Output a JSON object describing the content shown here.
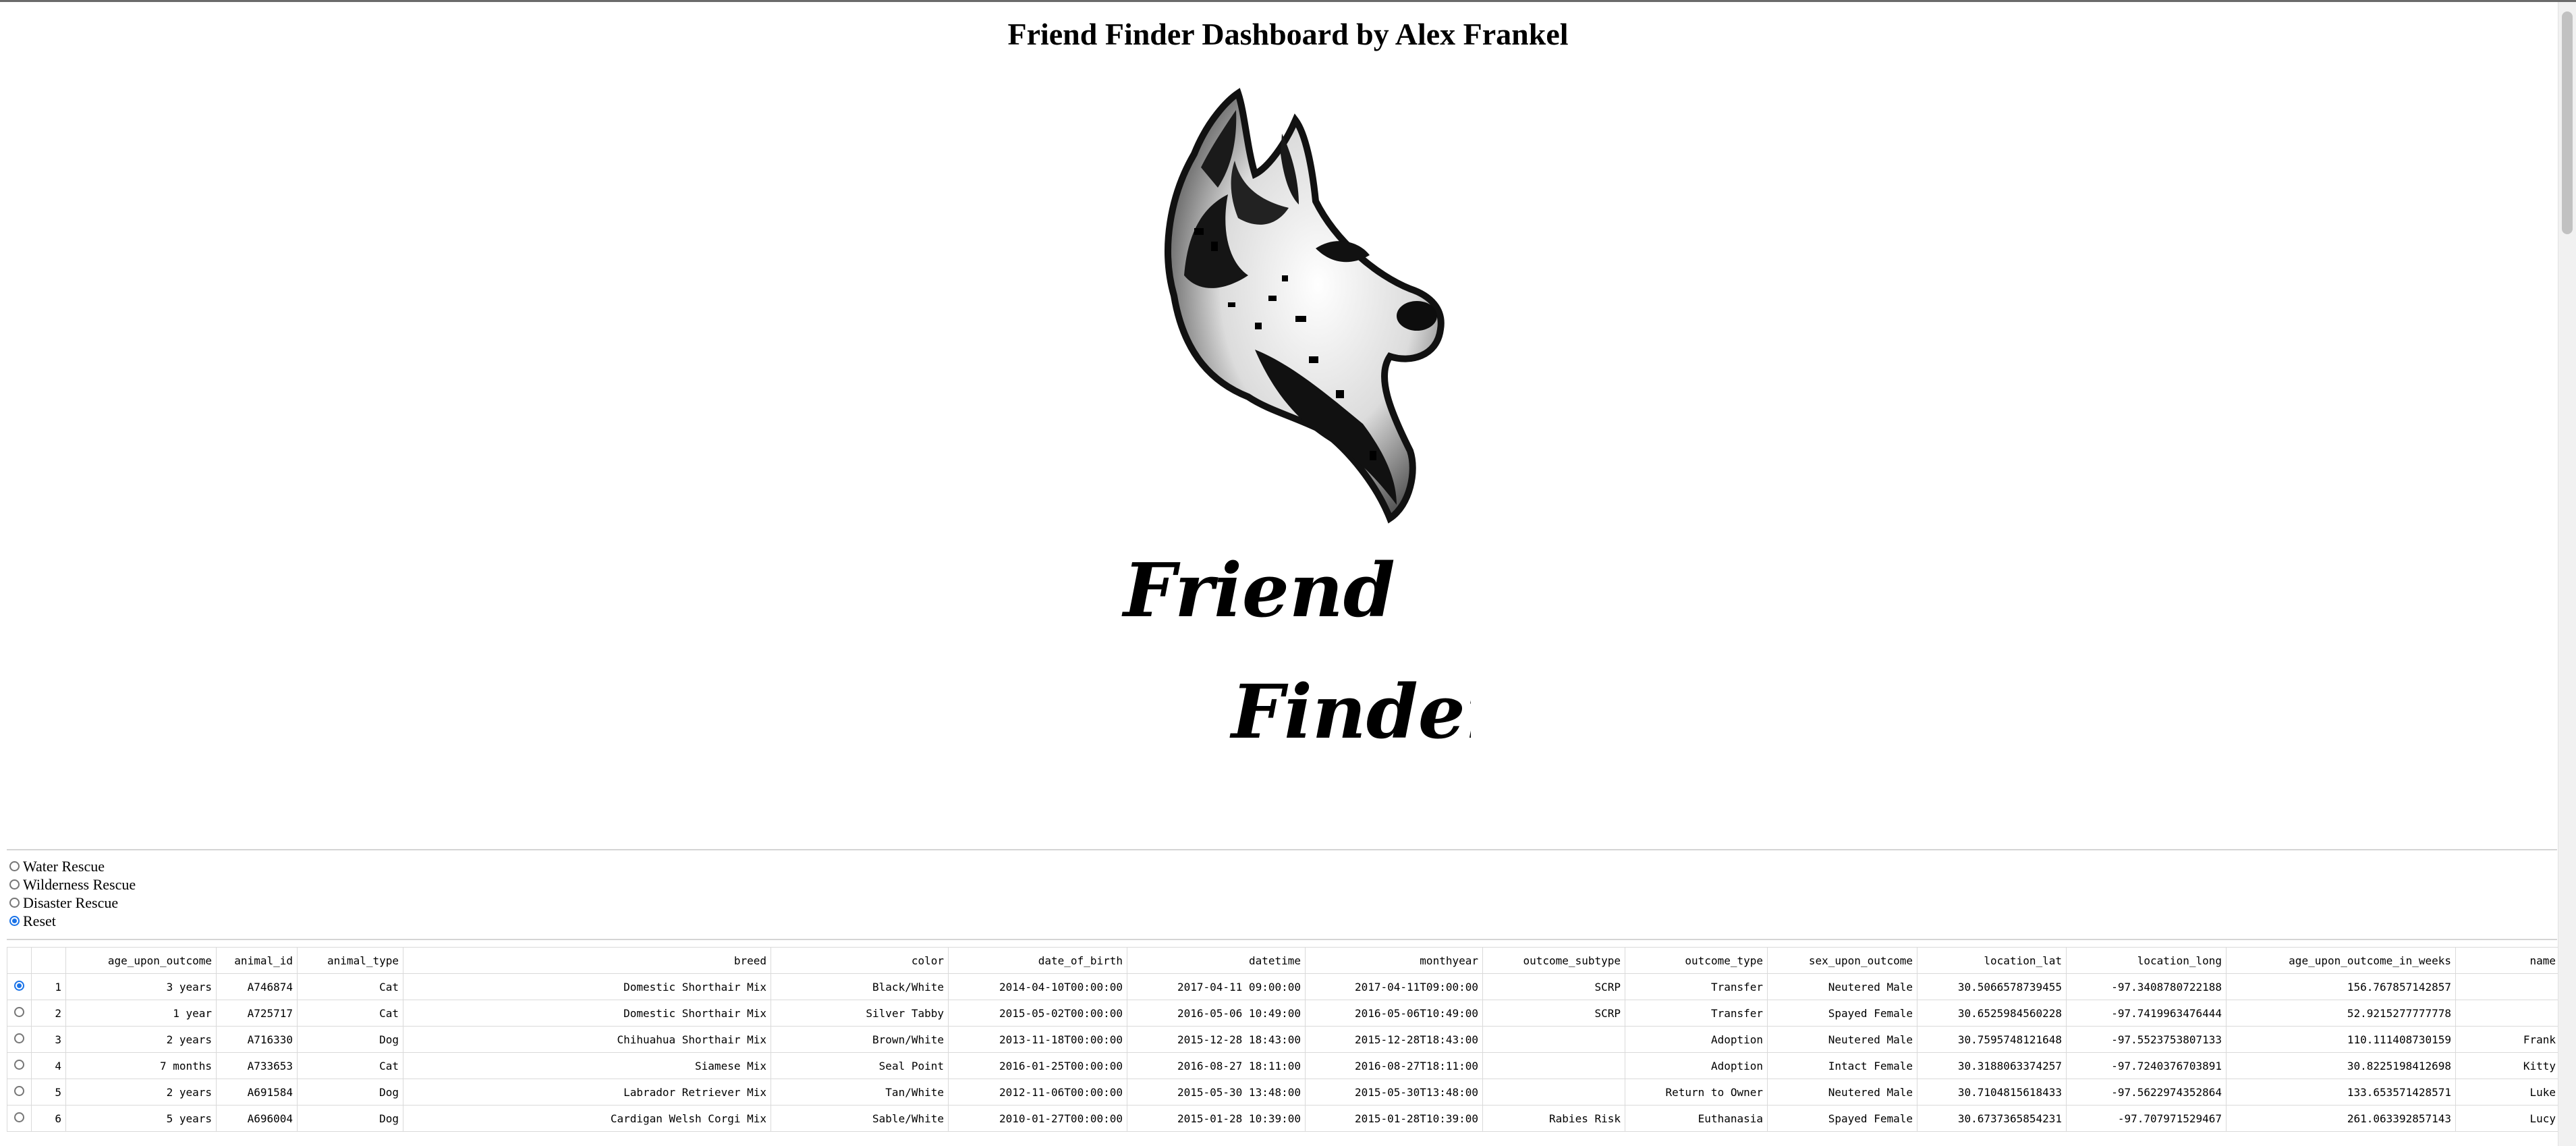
{
  "header": {
    "title": "Friend Finder Dashboard by Alex Frankel"
  },
  "logo": {
    "line1": "Friend",
    "line2": "Finder"
  },
  "filters": {
    "options": [
      {
        "label": "Water Rescue",
        "selected": false
      },
      {
        "label": "Wilderness Rescue",
        "selected": false
      },
      {
        "label": "Disaster Rescue",
        "selected": false
      },
      {
        "label": "Reset",
        "selected": true
      }
    ]
  },
  "table": {
    "columns": [
      "",
      "",
      "age_upon_outcome",
      "animal_id",
      "animal_type",
      "breed",
      "color",
      "date_of_birth",
      "datetime",
      "monthyear",
      "outcome_subtype",
      "outcome_type",
      "sex_upon_outcome",
      "location_lat",
      "location_long",
      "age_upon_outcome_in_weeks",
      "name"
    ],
    "rows": [
      [
        "1",
        "3 years",
        "A746874",
        "Cat",
        "Domestic Shorthair Mix",
        "Black/White",
        "2014-04-10T00:00:00",
        "2017-04-11 09:00:00",
        "2017-04-11T09:00:00",
        "SCRP",
        "Transfer",
        "Neutered Male",
        "30.5066578739455",
        "-97.3408780722188",
        "156.767857142857",
        ""
      ],
      [
        "2",
        "1 year",
        "A725717",
        "Cat",
        "Domestic Shorthair Mix",
        "Silver Tabby",
        "2015-05-02T00:00:00",
        "2016-05-06 10:49:00",
        "2016-05-06T10:49:00",
        "SCRP",
        "Transfer",
        "Spayed Female",
        "30.6525984560228",
        "-97.7419963476444",
        "52.9215277777778",
        ""
      ],
      [
        "3",
        "2 years",
        "A716330",
        "Dog",
        "Chihuahua Shorthair Mix",
        "Brown/White",
        "2013-11-18T00:00:00",
        "2015-12-28 18:43:00",
        "2015-12-28T18:43:00",
        "",
        "Adoption",
        "Neutered Male",
        "30.7595748121648",
        "-97.5523753807133",
        "110.111408730159",
        "Frank"
      ],
      [
        "4",
        "7 months",
        "A733653",
        "Cat",
        "Siamese Mix",
        "Seal Point",
        "2016-01-25T00:00:00",
        "2016-08-27 18:11:00",
        "2016-08-27T18:11:00",
        "",
        "Adoption",
        "Intact Female",
        "30.3188063374257",
        "-97.7240376703891",
        "30.8225198412698",
        "Kitty"
      ],
      [
        "5",
        "2 years",
        "A691584",
        "Dog",
        "Labrador Retriever Mix",
        "Tan/White",
        "2012-11-06T00:00:00",
        "2015-05-30 13:48:00",
        "2015-05-30T13:48:00",
        "",
        "Return to Owner",
        "Neutered Male",
        "30.7104815618433",
        "-97.5622974352864",
        "133.653571428571",
        "Luke"
      ],
      [
        "6",
        "5 years",
        "A696004",
        "Dog",
        "Cardigan Welsh Corgi Mix",
        "Sable/White",
        "2010-01-27T00:00:00",
        "2015-01-28 10:39:00",
        "2015-01-28T10:39:00",
        "Rabies Risk",
        "Euthanasia",
        "Spayed Female",
        "30.6737365854231",
        "-97.707971529467",
        "261.063392857143",
        "Lucy"
      ]
    ],
    "selected_row": 0
  }
}
